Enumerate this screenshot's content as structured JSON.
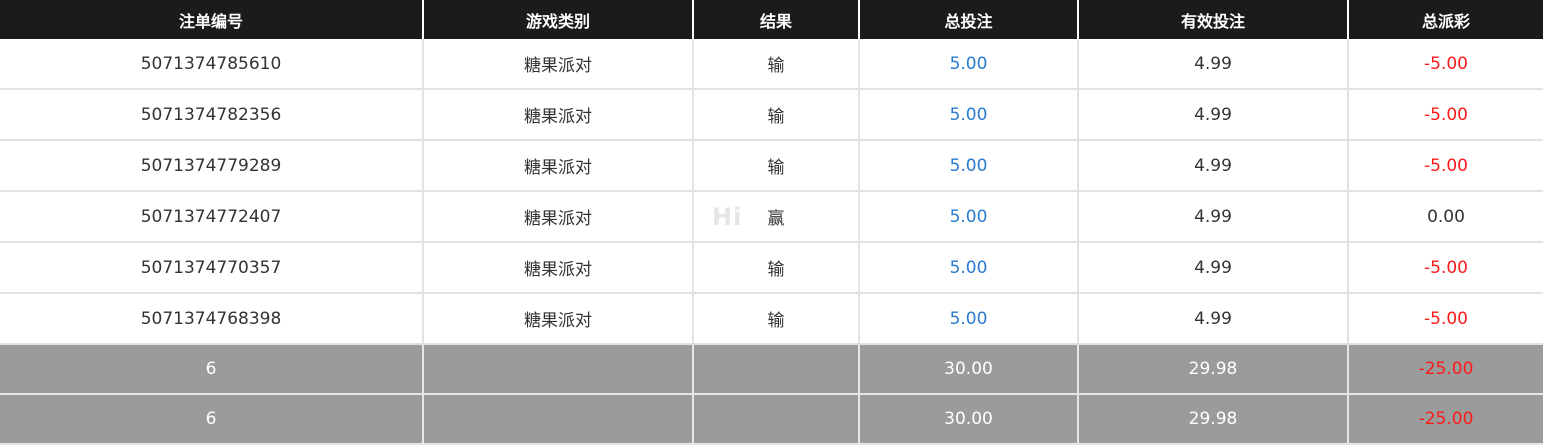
{
  "table": {
    "headers": [
      "注单编号",
      "游戏类别",
      "结果",
      "总投注",
      "有效投注",
      "总派彩"
    ],
    "rows": [
      {
        "id": "5071374785610",
        "game": "糖果派对",
        "result": "输",
        "total_bet": "5.00",
        "valid_bet": "4.99",
        "payout": "-5.00"
      },
      {
        "id": "5071374782356",
        "game": "糖果派对",
        "result": "输",
        "total_bet": "5.00",
        "valid_bet": "4.99",
        "payout": "-5.00"
      },
      {
        "id": "5071374779289",
        "game": "糖果派对",
        "result": "输",
        "total_bet": "5.00",
        "valid_bet": "4.99",
        "payout": "-5.00"
      },
      {
        "id": "5071374772407",
        "game": "糖果派对",
        "result": "赢",
        "total_bet": "5.00",
        "valid_bet": "4.99",
        "payout": "0.00"
      },
      {
        "id": "5071374770357",
        "game": "糖果派对",
        "result": "输",
        "total_bet": "5.00",
        "valid_bet": "4.99",
        "payout": "-5.00"
      },
      {
        "id": "5071374768398",
        "game": "糖果派对",
        "result": "输",
        "total_bet": "5.00",
        "valid_bet": "4.99",
        "payout": "-5.00"
      }
    ],
    "summary": [
      {
        "count": "6",
        "total_bet": "30.00",
        "valid_bet": "29.98",
        "payout": "-25.00"
      },
      {
        "count": "6",
        "total_bet": "30.00",
        "valid_bet": "29.98",
        "payout": "-25.00"
      }
    ]
  },
  "watermark": "Hi",
  "colors": {
    "header_bg": "#1b1b1b",
    "bet_blue": "#2a7ad0",
    "loss_red": "#ff1a1a",
    "summary_bg": "#9b9b9b"
  }
}
